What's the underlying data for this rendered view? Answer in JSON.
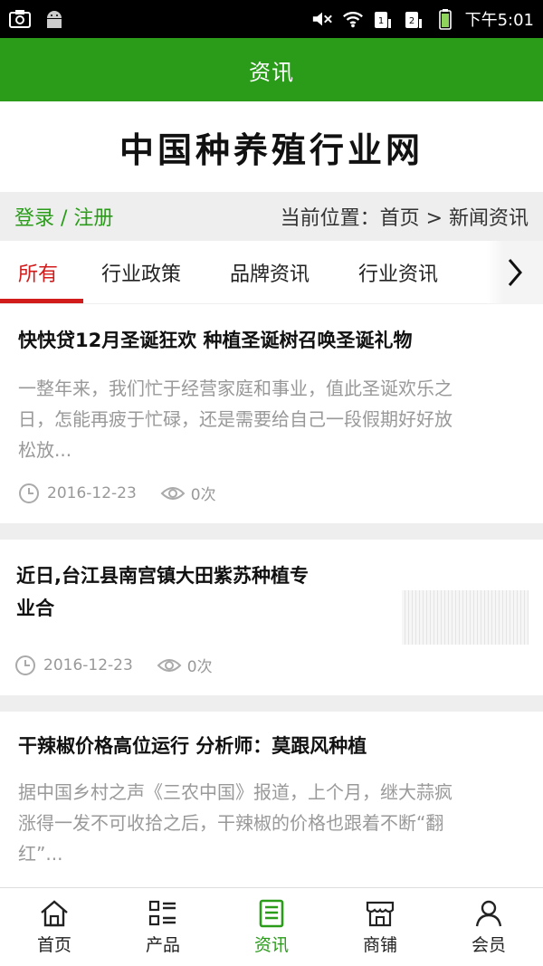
{
  "status_bar": {
    "time": "下午5:01"
  },
  "header": {
    "title": "资讯"
  },
  "logo": {
    "text": "中国种养殖行业网"
  },
  "crumbbar": {
    "login": "登录 / 注册",
    "location": "当前位置：首页 > 新闻资讯"
  },
  "tabs": [
    {
      "label": "所有",
      "active": true
    },
    {
      "label": "行业政策"
    },
    {
      "label": "品牌资讯"
    },
    {
      "label": "行业资讯"
    }
  ],
  "articles": [
    {
      "title": "快快贷12月圣诞狂欢 种植圣诞树召唤圣诞礼物",
      "summary_lines": [
        "一整年来，我们忙于经营家庭和事业，值此圣诞欢乐之",
        "日，怎能再疲于忙碌，还是需要给自己一段假期好好放",
        "松放..."
      ],
      "date": "2016-12-23",
      "views": "0次"
    },
    {
      "title_lines": [
        "近日,台江县南宫镇大田紫苏种植专",
        "业合"
      ],
      "date": "2016-12-23",
      "views": "0次"
    },
    {
      "title": "干辣椒价格高位运行 分析师：莫跟风种植",
      "summary_lines": [
        "据中国乡村之声《三农中国》报道，上个月，继大蒜疯",
        "涨得一发不可收拾之后，干辣椒的价格也跟着不断“翻",
        "红”..."
      ]
    }
  ],
  "bottom_nav": [
    {
      "label": "首页",
      "icon": "home-icon"
    },
    {
      "label": "产品",
      "icon": "grid-list-icon"
    },
    {
      "label": "资讯",
      "icon": "news-icon",
      "active": true
    },
    {
      "label": "商铺",
      "icon": "shop-icon"
    },
    {
      "label": "会员",
      "icon": "user-icon"
    }
  ],
  "colors": {
    "brand_green": "#2a9c1a",
    "active_tab_red": "#d21c1c",
    "muted_gray": "#999999"
  }
}
